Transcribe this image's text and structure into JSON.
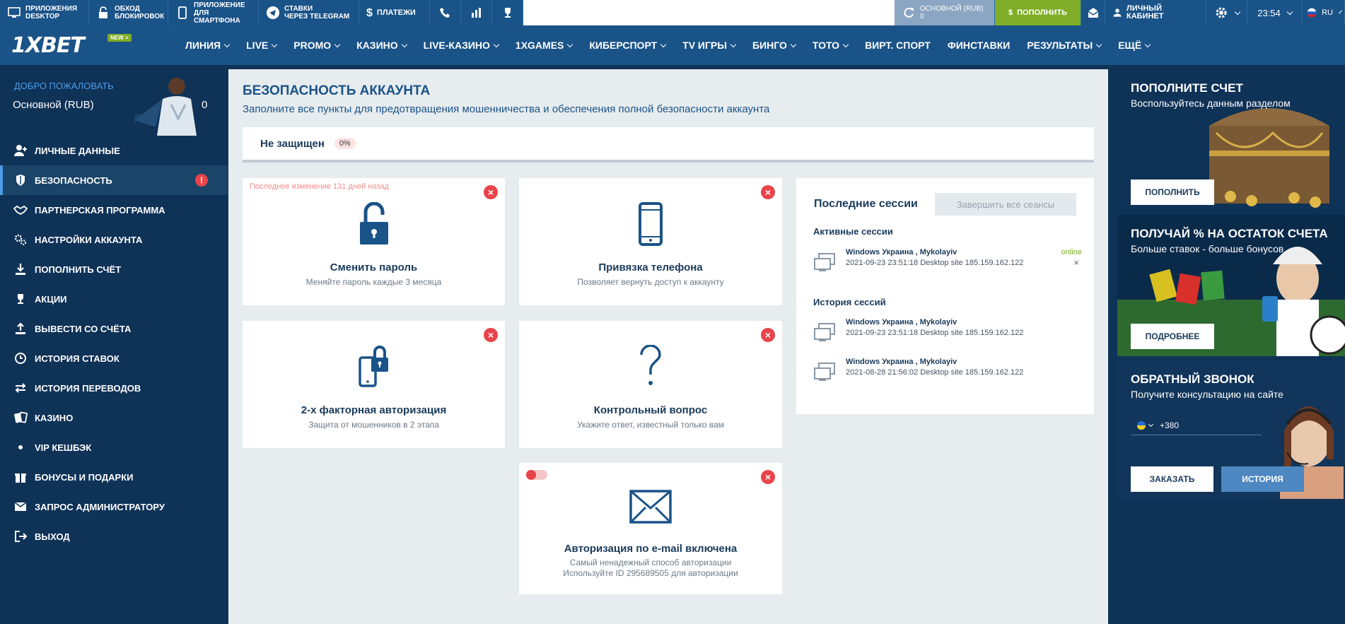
{
  "topbar": {
    "apps_desktop": "ПРИЛОЖЕНИЯ DESKTOP",
    "apps_desktop_l1": "ПРИЛОЖЕНИЯ",
    "apps_desktop_l2": "DESKTOP",
    "bypass_l1": "ОБХОД",
    "bypass_l2": "БЛОКИРОВОК",
    "mobile_l1": "ПРИЛОЖЕНИЕ",
    "mobile_l2": "ДЛЯ СМАРТФОНА",
    "telegram_l1": "СТАВКИ",
    "telegram_l2": "ЧЕРЕЗ TELEGRAM",
    "payments": "ПЛАТЕЖИ",
    "balance_label": "ОСНОВНОЙ (RUB)",
    "balance_value": "0",
    "deposit": "ПОПОЛНИТЬ",
    "cabinet": "ЛИЧНЫЙ КАБИНЕТ",
    "time": "23:54",
    "lang": "RU"
  },
  "nav": {
    "logo": "1XBET",
    "new_badge": "NEW >",
    "items": [
      "ЛИНИЯ",
      "LIVE",
      "PROMO",
      "КАЗИНО",
      "LIVE-КАЗИНО",
      "1XGAMES",
      "КИБЕРСПОРТ",
      "TV ИГРЫ",
      "БИНГО",
      "ТОТО",
      "ВИРТ. СПОРТ",
      "ФИНСТАВКИ",
      "РЕЗУЛЬТАТЫ",
      "ЕЩЁ"
    ]
  },
  "sidebar": {
    "welcome": "ДОБРО ПОЖАЛОВАТЬ",
    "account": "Основной (RUB)",
    "balance": "0",
    "items": [
      {
        "label": "ЛИЧНЫЕ ДАННЫЕ",
        "icon": "user-plus-icon"
      },
      {
        "label": "БЕЗОПАСНОСТЬ",
        "icon": "shield-icon"
      },
      {
        "label": "ПАРТНЕРСКАЯ ПРОГРАММА",
        "icon": "handshake-icon"
      },
      {
        "label": "НАСТРОЙКИ АККАУНТА",
        "icon": "gears-icon"
      },
      {
        "label": "ПОПОЛНИТЬ СЧЁТ",
        "icon": "download-icon"
      },
      {
        "label": "АКЦИИ",
        "icon": "trophy-icon"
      },
      {
        "label": "ВЫВЕСТИ СО СЧЁТА",
        "icon": "upload-icon"
      },
      {
        "label": "ИСТОРИЯ СТАВОК",
        "icon": "clock-icon"
      },
      {
        "label": "ИСТОРИЯ ПЕРЕВОДОВ",
        "icon": "transfer-icon"
      },
      {
        "label": "КАЗИНО",
        "icon": "cards-icon"
      },
      {
        "label": "VIP КЕШБЭК",
        "icon": "dot-icon"
      },
      {
        "label": "БОНУСЫ И ПОДАРКИ",
        "icon": "gift-icon"
      },
      {
        "label": "ЗАПРОС АДМИНИСТРАТОРУ",
        "icon": "envelope-icon"
      },
      {
        "label": "ВЫХОД",
        "icon": "logout-icon"
      }
    ],
    "alert": "!"
  },
  "main": {
    "title": "БЕЗОПАСНОСТЬ АККАУНТА",
    "subtitle": "Заполните все пункты для предотвращения мошенничества и обеспечения полной безопасности аккаунта",
    "status": "Не защищен",
    "percent": "0%",
    "cards": {
      "password": {
        "note": "Последнее изменение 131 дней назад",
        "title": "Сменить пароль",
        "desc": "Меняйте пароль каждые 3 месяца"
      },
      "phone": {
        "title": "Привязка телефона",
        "desc": "Позволяет вернуть доступ к аккаунту"
      },
      "twofa": {
        "title": "2-х факторная авторизация",
        "desc": "Защита от мошенников в 2 этапа"
      },
      "question": {
        "title": "Контрольный вопрос",
        "desc": "Укажите ответ, известный только вам"
      },
      "email": {
        "title": "Авторизация по e-mail включена",
        "desc1": "Самый ненадежный способ авторизации",
        "desc2": "Используйте ID 295689505 для авторизации"
      }
    },
    "close_glyph": "×"
  },
  "sessions": {
    "title": "Последние сессии",
    "end_all": "Завершить все сеансы",
    "active_label": "Активные сессии",
    "history_label": "История сессий",
    "active": [
      {
        "name": "Windows Украина , Mykolayiv",
        "info": "2021-09-23 23:51:18 Desktop site 185.159.162.122",
        "status": "online",
        "close": "×"
      }
    ],
    "history": [
      {
        "name": "Windows Украина , Mykolayiv",
        "info": "2021-09-23 23:51:18 Desktop site 185.159.162.122"
      },
      {
        "name": "Windows Украина , Mykolayiv",
        "info": "2021-08-28 21:56:02 Desktop site 185.159.162.122"
      }
    ]
  },
  "promos": {
    "deposit": {
      "title": "ПОПОЛНИТЕ СЧЕТ",
      "sub": "Воспользуйтесь данным разделом",
      "button": "ПОПОЛНИТЬ"
    },
    "percent": {
      "title": "ПОЛУЧАЙ % НА ОСТАТОК СЧЕТА",
      "sub": "Больше ставок - больше бонусов",
      "button": "ПОДРОБНЕЕ"
    },
    "callback": {
      "title": "ОБРАТНЫЙ ЗВОНОК",
      "sub": "Получите консультацию на сайте",
      "phone_prefix": "+380",
      "order": "ЗАКАЗАТЬ",
      "history": "ИСТОРИЯ"
    }
  },
  "colors": {
    "brand_blue": "#1a5388",
    "dark_blue": "#0f3257",
    "accent_green": "#7fad27",
    "danger_red": "#e8444a"
  }
}
